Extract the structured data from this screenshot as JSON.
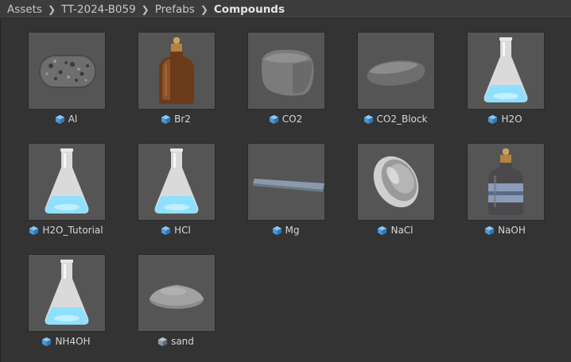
{
  "breadcrumb": {
    "items": [
      "Assets",
      "TT-2024-B059",
      "Prefabs"
    ],
    "current": "Compounds"
  },
  "assets": [
    {
      "name": "Al",
      "thumbnail": "rock-capsule"
    },
    {
      "name": "Br2",
      "thumbnail": "amber-dropper-bottle"
    },
    {
      "name": "CO2",
      "thumbnail": "grey-block"
    },
    {
      "name": "CO2_Block",
      "thumbnail": "flat-slab"
    },
    {
      "name": "H2O",
      "thumbnail": "erlenmeyer-flask"
    },
    {
      "name": "H2O_Tutorial",
      "thumbnail": "erlenmeyer-flask"
    },
    {
      "name": "HCl",
      "thumbnail": "erlenmeyer-flask"
    },
    {
      "name": "Mg",
      "thumbnail": "metal-strip"
    },
    {
      "name": "NaCl",
      "thumbnail": "petri-dish"
    },
    {
      "name": "NaOH",
      "thumbnail": "labeled-bottle"
    },
    {
      "name": "NH4OH",
      "thumbnail": "erlenmeyer-flask"
    },
    {
      "name": "sand",
      "thumbnail": "sand-pile"
    }
  ],
  "icon": "prefab-cube-icon",
  "colors": {
    "prefab_icon": "#5aa9e6",
    "variant_icon": "#8e9aa6"
  }
}
